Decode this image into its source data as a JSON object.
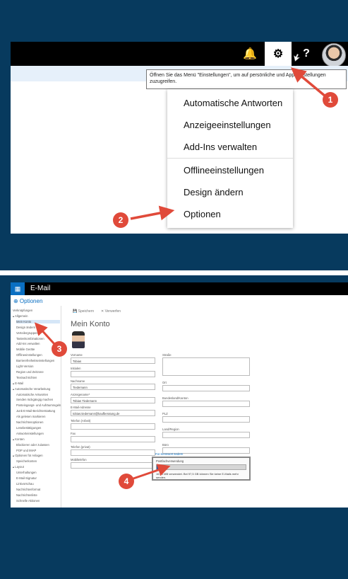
{
  "colors": {
    "panel_bg": "#073a5e",
    "badge": "#e04a3a",
    "accent": "#0a6fc2",
    "arrow": "#e04a3a"
  },
  "step1": {
    "icons": [
      "bell-icon",
      "gear-icon",
      "question-icon",
      "avatar"
    ],
    "bell_glyph": "🔔",
    "gear_glyph": "⚙",
    "help_glyph": "?",
    "tooltip": "Öffnen Sie das Menü \"Einstellungen\", um auf persönliche und App-Einstellungen zuzugreifen.",
    "menu": {
      "items": [
        "Automatische Antworten",
        "Anzeigeeinstellungen",
        "Add-Ins verwalten",
        "Offlineeinstellungen",
        "Design ändern",
        "Optionen"
      ]
    },
    "badges": [
      "1",
      "2"
    ]
  },
  "step2": {
    "app_title": "E-Mail",
    "waffle_glyph": "▦",
    "options_link": "⊕ Optionen",
    "sidebar": [
      "Verknüpfungen",
      "▴ Allgemein",
      "Mein Konto",
      "Design ändern",
      "Verteilergruppen",
      "Tastenkombinationen",
      "Add-Ins verwalten",
      "Mobile Geräte",
      "Offlineeinstellungen",
      "Barrierefreiheitseinstellungen",
      "Light-Version",
      "Region und Zeitzone",
      "Textnachrichten",
      "▴ E-Mail",
      "▴ Automatische Verarbeitung",
      "Automatische Antworten",
      "Senden rückgängig machen",
      "Posteingangs- und Aufräumregeln",
      "Junk-E-Mail-Berichterstattung",
      "Als gelesen markieren",
      "Nachrichtenoptionen",
      "Lesebestätigungen",
      "Antworteinstellungen",
      "▴ Konten",
      "Blockieren oder zulassen",
      "POP und IMAP",
      "▴ Optionen für Anlagen",
      "Speicherkonten",
      "▴ Layout",
      "Unterhaltungen",
      "E-Mail-Signatur",
      "Linkvorschau",
      "Nachrichtenformat",
      "Nachrichtenliste",
      "Schnelle Aktionen"
    ],
    "toolbar": {
      "save": "💾 Speichern",
      "discard": "✕ Verwerfen"
    },
    "page_title": "Mein Konto",
    "fields_left": [
      {
        "label": "Vorname",
        "value": "Tobias"
      },
      {
        "label": "Initialen",
        "value": ""
      },
      {
        "label": "Nachname",
        "value": "Tiedemann"
      },
      {
        "label": "Anzeigename*",
        "value": "Tobias Tiedemann"
      },
      {
        "label": "E-Mail-Adresse",
        "value": "tobias.tiedemann@kaufberatung.de"
      },
      {
        "label": "Telefon (Arbeit)",
        "value": ""
      },
      {
        "label": "Fax",
        "value": ""
      },
      {
        "label": "Telefon (privat)",
        "value": ""
      },
      {
        "label": "Mobiltelefon",
        "value": ""
      }
    ],
    "fields_right": [
      {
        "label": "Straße",
        "value": ""
      },
      {
        "label": "Ort",
        "value": ""
      },
      {
        "label": "Bundesland/Kanton",
        "value": ""
      },
      {
        "label": "PLZ",
        "value": ""
      },
      {
        "label": "Land/Region",
        "value": ""
      },
      {
        "label": "Büro",
        "value": ""
      }
    ],
    "more_link": "Für Kennwort ändern",
    "usage": {
      "title": "Postfachverwendung",
      "percent_used": 0.01,
      "text": "16,04 MB verwendet. Bei 97,5 GB können Sie keine E-Mails mehr senden."
    },
    "badges": [
      "3",
      "4"
    ]
  }
}
